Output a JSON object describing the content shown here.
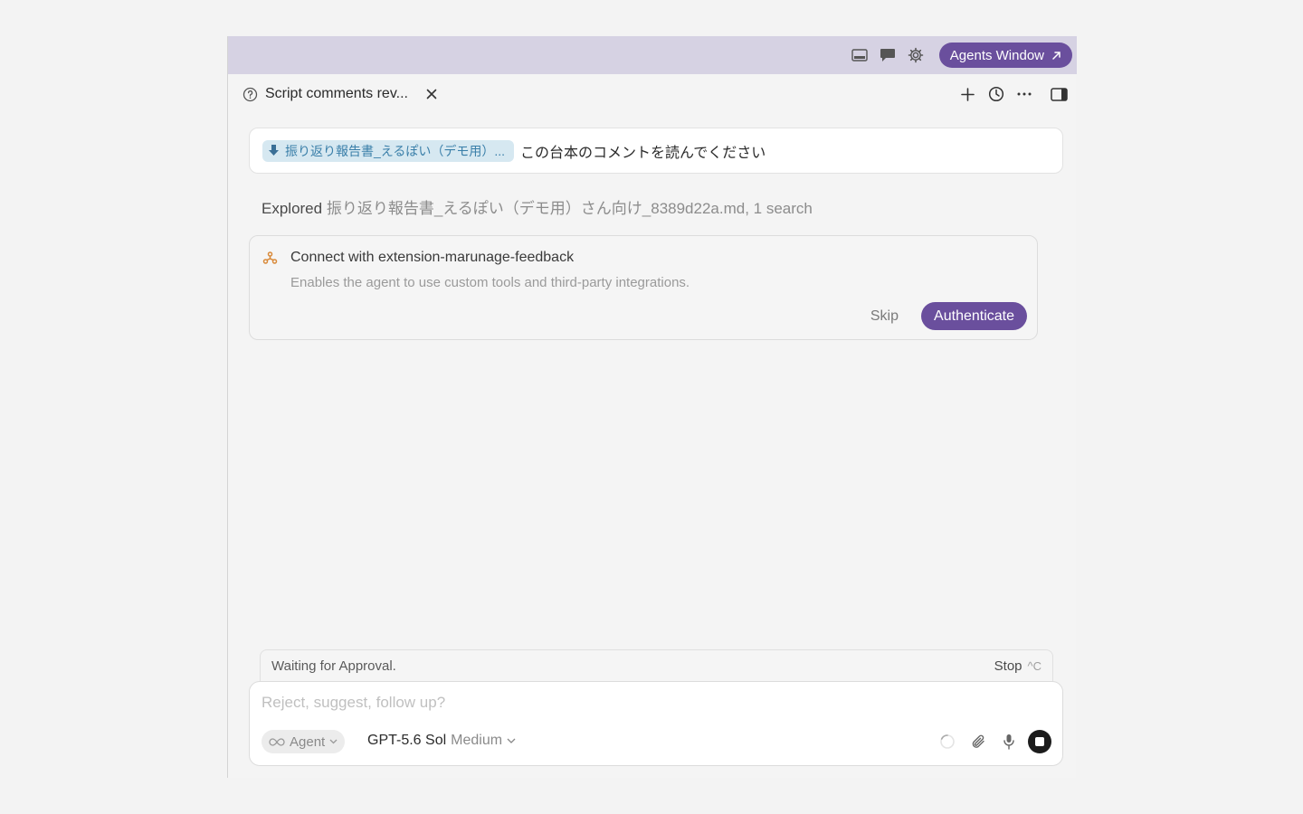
{
  "titlebar": {
    "icons": [
      "panel-icon",
      "chat-icon",
      "gear-icon"
    ],
    "agents_window_label": "Agents Window"
  },
  "tab": {
    "title": "Script comments rev...",
    "icon": "help-circle-icon"
  },
  "tab_actions": [
    "plus-icon",
    "history-icon",
    "more-icon",
    "toggle-sidebar-icon"
  ],
  "user_message": {
    "file_chip": "振り返り報告書_えるぽい（デモ用）...",
    "text": "この台本のコメントを読んでください"
  },
  "explored": {
    "verb": "Explored",
    "detail": "振り返り報告書_えるぽい（デモ用）さん向け_8389d22a.md, 1 search"
  },
  "connect_card": {
    "title": "Connect with extension-marunage-feedback",
    "description": "Enables the agent to use custom tools and third-party integrations.",
    "skip_label": "Skip",
    "authenticate_label": "Authenticate"
  },
  "status": {
    "text": "Waiting for Approval.",
    "stop_label": "Stop",
    "stop_shortcut": "^C"
  },
  "composer": {
    "placeholder": "Reject, suggest, follow up?",
    "mode_label": "Agent",
    "model_name": "GPT-5.6 Sol",
    "model_level": "Medium"
  },
  "colors": {
    "accent": "#6a4f9d",
    "titlebar": "#d6d2e3",
    "file_chip_bg": "#d6e8f1",
    "file_chip_text": "#3a7fa9"
  }
}
